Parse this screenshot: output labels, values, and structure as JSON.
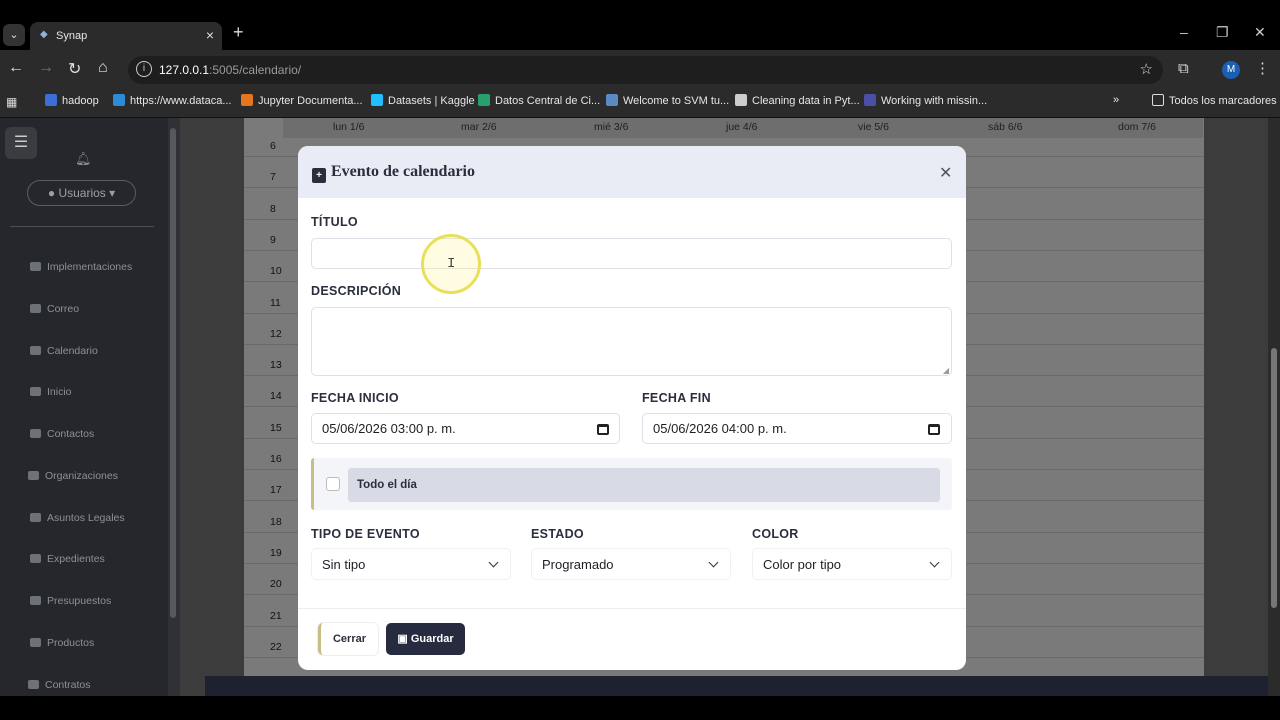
{
  "browser": {
    "tab_title": "Synap",
    "url_host": "127.0.0.1",
    "url_rest": ":5005/calendario/",
    "profile_initial": "M",
    "bookmarks": [
      "hadoop",
      "https://www.dataca...",
      "Jupyter Documenta...",
      "Datasets | Kaggle",
      "Datos Central de Ci...",
      "Welcome to SVM tu...",
      "Cleaning data in Pyt...",
      "Working with missin..."
    ],
    "all_bookmarks": "Todos los marcadores"
  },
  "sidebar": {
    "users_label": "Usuarios",
    "items": [
      "Implementaciones",
      "Correo",
      "Calendario",
      "Inicio",
      "Contactos",
      "Organizaciones",
      "Asuntos Legales",
      "Expedientes",
      "Presupuestos",
      "Productos",
      "Contratos"
    ]
  },
  "calendar": {
    "days": [
      "lun 1/6",
      "mar 2/6",
      "mié 3/6",
      "jue 4/6",
      "vie 5/6",
      "sáb 6/6",
      "dom 7/6"
    ],
    "hours": [
      "6",
      "7",
      "8",
      "9",
      "10",
      "11",
      "12",
      "13",
      "14",
      "15",
      "16",
      "17",
      "18",
      "19",
      "20",
      "21",
      "22"
    ]
  },
  "modal": {
    "title": "Evento de calendario",
    "titulo_label": "TÍTULO",
    "titulo_value": "",
    "descripcion_label": "DESCRIPCIÓN",
    "descripcion_value": "",
    "fecha_inicio_label": "FECHA INICIO",
    "fecha_inicio_value": "05/06/2026 03:00  p. m.",
    "fecha_fin_label": "FECHA FIN",
    "fecha_fin_value": "05/06/2026 04:00  p. m.",
    "todo_el_dia_label": "Todo el día",
    "todo_el_dia_checked": false,
    "tipo_label": "TIPO DE EVENTO",
    "tipo_value": "Sin tipo",
    "estado_label": "ESTADO",
    "estado_value": "Programado",
    "color_label": "COLOR",
    "color_value": "Color por tipo",
    "cerrar_label": "Cerrar",
    "guardar_label": "Guardar"
  },
  "colors": {
    "primary_button": "#262b40",
    "accent_border": "#c9bd86",
    "header_bg": "#e9ecf4"
  }
}
